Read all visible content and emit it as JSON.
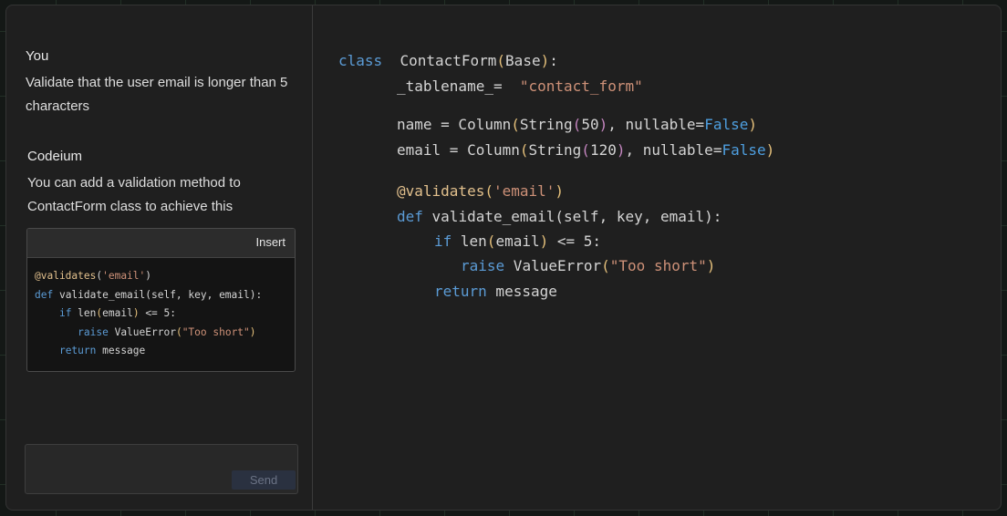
{
  "chat": {
    "user": {
      "label": "You",
      "message": "Validate that the user email is longer than 5 characters"
    },
    "assistant": {
      "label": "Codeium",
      "message": "You can add a validation method to ContactForm class to achieve this"
    },
    "snippet": {
      "insert_label": "Insert",
      "lines": [
        "@validates('email')",
        "def validate_email(self, key, email):",
        "if len(email) <= 5:",
        "raise ValueError(\"Too short\")",
        "return message"
      ]
    },
    "input": {
      "send_label": "Send"
    }
  },
  "editor": {
    "lines": [
      "class ContactForm(Base):",
      "_tablename_= \"contact_form\"",
      "name = Column(String(50), nullable=False)",
      "email = Column(String(120), nullable=False)",
      "@validates('email')",
      "def validate_email(self, key, email):",
      "if len(email) <= 5:",
      "raise ValueError(\"Too short\")",
      "return message"
    ]
  },
  "colors": {
    "keyword": "#5b9bd5",
    "string": "#ce9178",
    "paren": "#e5c07b",
    "boolean": "#4e9fe0"
  }
}
